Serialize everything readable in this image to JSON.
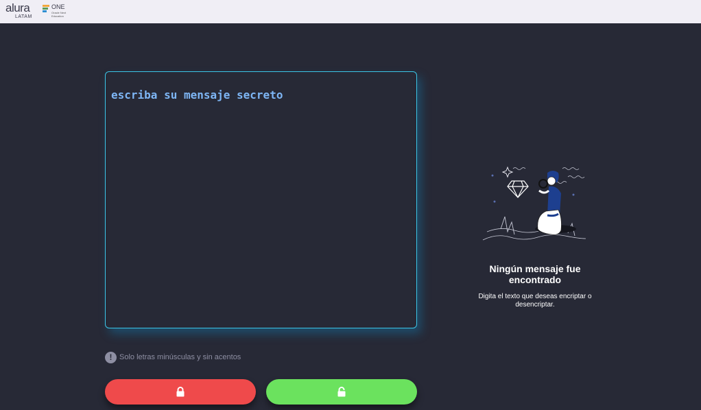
{
  "header": {
    "logo_alura": "alura",
    "logo_alura_sub": "LATAM",
    "logo_one": "ONE",
    "logo_one_sub": "Oracle Next Education"
  },
  "input": {
    "placeholder": "escriba su mensaje secreto",
    "value": ""
  },
  "hint": {
    "icon": "exclamation-icon",
    "text": "Solo letras minúsculas y sin acentos"
  },
  "buttons": {
    "encrypt_icon": "lock-icon",
    "decrypt_icon": "unlock-icon"
  },
  "result": {
    "title": "Ningún mensaje fue encontrado",
    "description": "Digita el texto que deseas encriptar o desencriptar."
  },
  "colors": {
    "background": "#272936",
    "accent_border": "#3bc6e8",
    "placeholder_text": "#7eb6f5",
    "encrypt_button": "#ef4a4b",
    "decrypt_button": "#6be25e"
  }
}
